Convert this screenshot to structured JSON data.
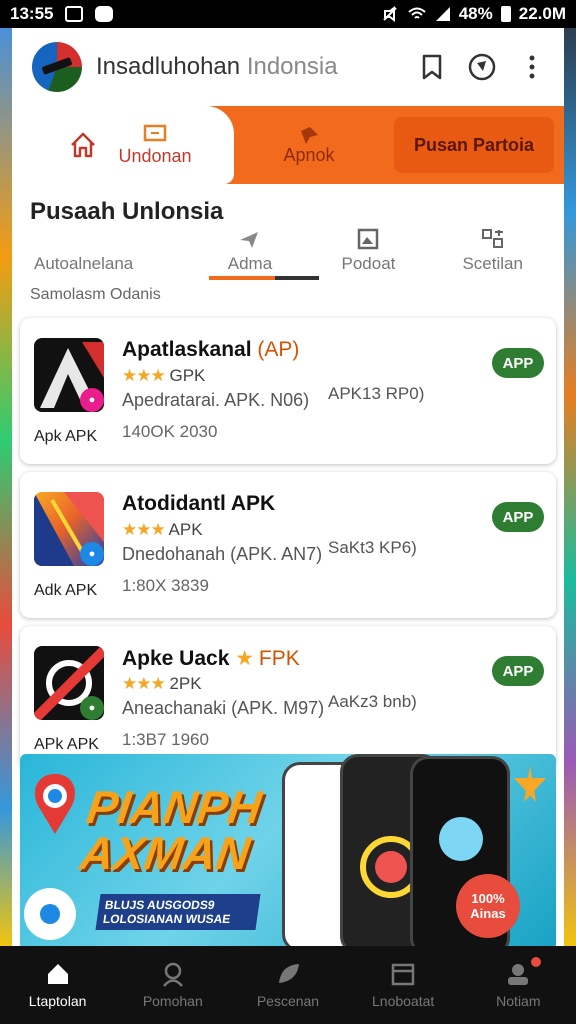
{
  "status_bar": {
    "time": "13:55",
    "battery": "48%",
    "clock_right": "22.0M"
  },
  "app_bar": {
    "title_main": "Insadluhohan",
    "title_light": "Indonsia"
  },
  "top_tabs": {
    "active_label": "Undonan",
    "mid_label": "Apnok",
    "button_label": "Pusan Partoia"
  },
  "section_title": "Pusaah Unlonsia",
  "filters": [
    {
      "label": "Autoalnelana"
    },
    {
      "label": "Adma"
    },
    {
      "label": "Podoat"
    },
    {
      "label": "Scetilan"
    }
  ],
  "hint": "Samolasm Odanis",
  "apps": [
    {
      "name": "Apatlaskanal",
      "name_hl": "(AP)",
      "rating_text": "GPK",
      "desc": "Apedratarai. APK. N06)",
      "size": "APK13 RP0)",
      "downloads": "140OK 2030",
      "caption": "Apk APK",
      "button": "APP",
      "icon_bg": "#111111",
      "badge_color": "#e91e8c"
    },
    {
      "name": "Atodidantl APK",
      "name_hl": "",
      "rating_text": "APK",
      "desc": "Dnedohanah (APK. AN7)",
      "size": "SaKt3 KP6)",
      "downloads": "1:80X 3839",
      "caption": "Adk APK",
      "button": "APP",
      "icon_bg": "#e8632a",
      "badge_color": "#1e88e5"
    },
    {
      "name": "Apke Uack",
      "name_hl": "FPK",
      "rating_text": "2PK",
      "desc": "Aneachanaki (APK. M97)",
      "size": "AaKz3 bnb)",
      "downloads": "1:3B7 1960",
      "caption": "APk APK",
      "button": "APP",
      "icon_bg": "#111111",
      "badge_color": "#2e7d32"
    }
  ],
  "banner": {
    "title_line1": "PIANPH",
    "title_line2": "AXMAN",
    "subtitle": "BLUJS AUSGODS9 LOLOSIANAN WUSAE",
    "phone_label": "100% Ainas"
  },
  "bottom_nav": [
    {
      "label": "Ltaptolan",
      "active": true
    },
    {
      "label": "Pomohan",
      "active": false
    },
    {
      "label": "Pescenan",
      "active": false
    },
    {
      "label": "Lnoboatat",
      "active": false
    },
    {
      "label": "Notiam",
      "active": false
    }
  ],
  "colors": {
    "accent_orange": "#f26b1d",
    "app_button_green": "#2e7d32",
    "banner_blue": "#29b6d8"
  }
}
